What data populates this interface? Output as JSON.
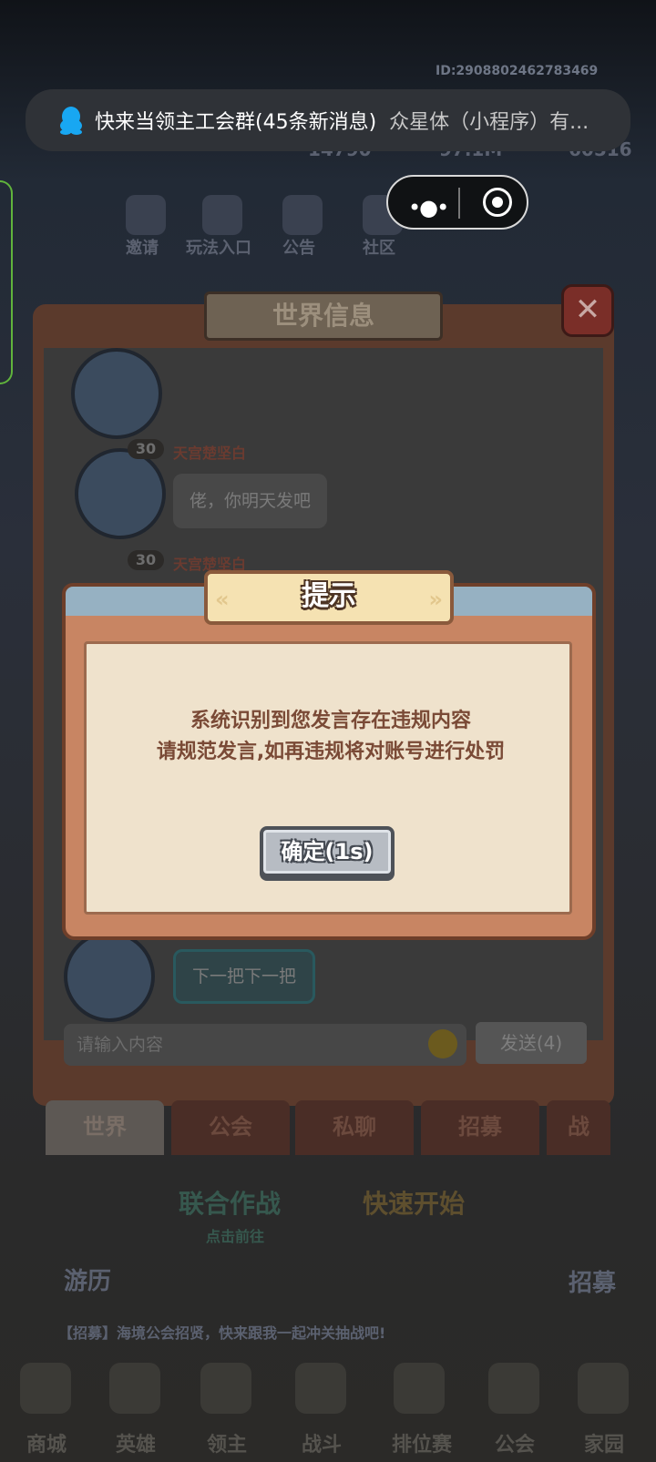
{
  "statusbar": {
    "id_text": "ID:2908802462783469"
  },
  "notification": {
    "main": "快来当领主工会群(45条新消息)",
    "secondary": "众星体（小程序）有..."
  },
  "background": {
    "top_stats": [
      "14790",
      "97.1M",
      "60516"
    ],
    "top_icons": [
      "邀请",
      "玩法入口",
      "公告",
      "社区"
    ],
    "mid_buttons": [
      "联合作战",
      "点击前往",
      "快速开始"
    ],
    "side_labels": [
      "游历",
      "招募"
    ],
    "broadcast": "【招募】海境公会招贤，快来跟我一起冲关抽战吧!",
    "bottom_nav": [
      "商城",
      "英雄",
      "领主",
      "战斗",
      "排位赛",
      "公会",
      "家园"
    ]
  },
  "world_chat": {
    "title": "世界信息",
    "close": "✕",
    "messages": [
      {
        "level": "30",
        "name": "天宫楚坚白",
        "text": "佬，你明天发吧"
      },
      {
        "level": "30",
        "name": "天宫楚坚白"
      },
      {
        "text": "下一把下一把"
      }
    ],
    "input_placeholder": "请输入内容",
    "send_label": "发送(4)",
    "tabs": [
      "世界",
      "公会",
      "私聊",
      "招募",
      "战"
    ]
  },
  "dialog": {
    "title": "提示",
    "line1": "系统识别到您发言存在违规内容",
    "line2": "请规范发言,如再违规将对账号进行处罚",
    "confirm": "确定(1s)"
  },
  "colors": {
    "dialog_bg": "#efe2cc",
    "dialog_text": "#7a4a36",
    "confirm_bg": "#b7bcc3",
    "notification_bg": "#2f3237"
  }
}
